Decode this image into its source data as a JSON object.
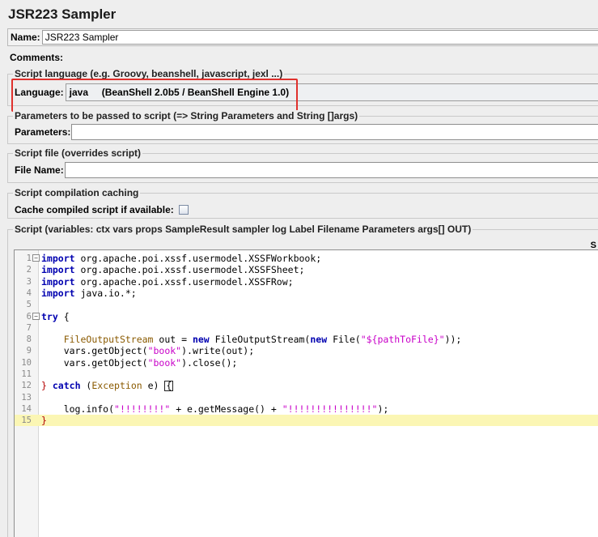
{
  "title": "JSR223 Sampler",
  "name_field": {
    "label": "Name:",
    "value": "JSR223 Sampler"
  },
  "comments_field": {
    "label": "Comments:"
  },
  "script_language": {
    "legend": "Script language (e.g. Groovy, beanshell, javascript, jexl ...)",
    "label": "Language:",
    "value": "java     (BeanShell 2.0b5 / BeanShell Engine 1.0)"
  },
  "parameters": {
    "legend": "Parameters to be passed to script (=> String Parameters and String []args)",
    "label": "Parameters:"
  },
  "script_file": {
    "legend": "Script file (overrides script)",
    "label": "File Name:"
  },
  "compilation": {
    "legend": "Script compilation caching",
    "label": "Cache compiled script if available:",
    "checked": false
  },
  "script": {
    "legend": "Script (variables: ctx vars props SampleResult sampler log Label Filename Parameters args[] OUT)",
    "right_label": "S",
    "current_line": 15,
    "lines": [
      {
        "num": "1",
        "fold": "−"
      },
      {
        "num": "2"
      },
      {
        "num": "3"
      },
      {
        "num": "4"
      },
      {
        "num": "5"
      },
      {
        "num": "6",
        "fold": "−"
      },
      {
        "num": "7"
      },
      {
        "num": "8"
      },
      {
        "num": "9"
      },
      {
        "num": "10"
      },
      {
        "num": "11"
      },
      {
        "num": "12"
      },
      {
        "num": "13"
      },
      {
        "num": "14"
      },
      {
        "num": "15"
      }
    ],
    "text": {
      "l1": "org.apache.poi.xssf.usermodel.XSSFWorkbook;",
      "l2": "org.apache.poi.xssf.usermodel.XSSFSheet;",
      "l3": "org.apache.poi.xssf.usermodel.XSSFRow;",
      "l4": "java.io.*;",
      "kw_import": "import",
      "kw_try": "try",
      "brace_open": " {",
      "l8_type": "FileOutputStream",
      "l8_a": " out = ",
      "kw_new": "new",
      "l8_b": " FileOutputStream(",
      "l8_c": " File(",
      "l8_str": "\"${pathToFile}\"",
      "l8_end": "));",
      "l9_a": "vars.getObject(",
      "str_book": "\"book\"",
      "l9_b": ").write(out);",
      "l10_b": ").close();",
      "brace_close": "}",
      "kw_catch": "catch",
      "l12_a": " (",
      "l12_type": "Exception",
      "l12_b": " e) ",
      "l12_caret": "{",
      "l14_a": "log.info(",
      "l14_s1": "\"!!!!!!!!\"",
      "l14_b": " + e.getMessage() + ",
      "l14_s2": "\"!!!!!!!!!!!!!!!\"",
      "l14_end": ");"
    }
  },
  "colors": {
    "highlight_box": "#e0312d",
    "keyword": "#0000b0",
    "string": "#c800c8",
    "current_line": "#fbf6b4"
  }
}
